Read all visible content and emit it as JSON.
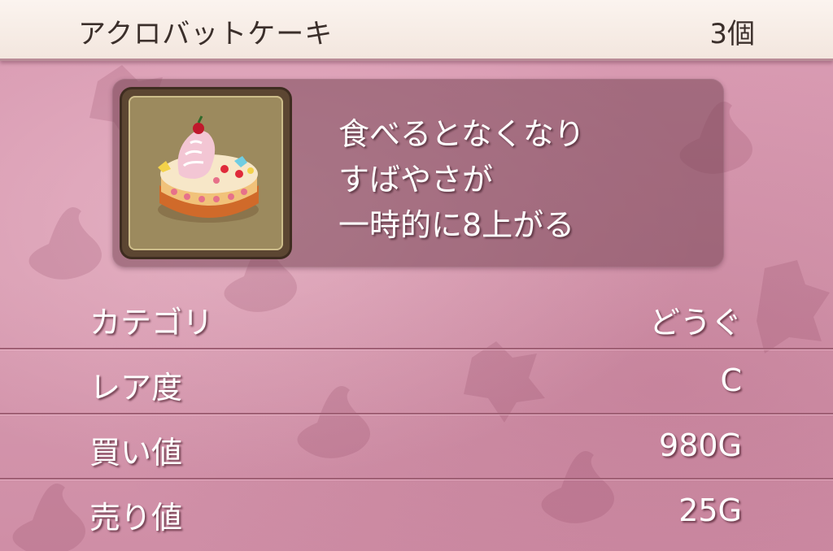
{
  "header": {
    "item_name": "アクロバットケーキ",
    "count": "3個"
  },
  "item": {
    "icon": "acrobat-cake-icon",
    "description_lines": [
      "食べるとなくなり",
      "すばやさが",
      "一時的に8上がる"
    ]
  },
  "stats": [
    {
      "label": "カテゴリ",
      "value": "どうぐ"
    },
    {
      "label": "レア度",
      "value": "C"
    },
    {
      "label": "買い値",
      "value": "980G"
    },
    {
      "label": "売り値",
      "value": "25G"
    }
  ],
  "colors": {
    "background": "#d99ab2",
    "header_bg": "#fbf4ef",
    "panel_bg": "#784655",
    "text": "#ffffff",
    "header_text": "#3b2f2b"
  }
}
